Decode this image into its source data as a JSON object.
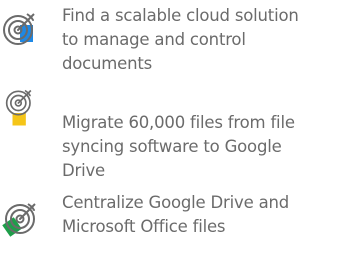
{
  "goals": [
    {
      "icon": "target-icon",
      "accent": "#1e88e5",
      "lines": [
        "Find a scalable cloud solution",
        "to manage and control",
        "documents"
      ]
    },
    {
      "icon": "target-icon",
      "accent": "#f5c518",
      "lines": [
        "Migrate 60,000 files from file",
        "syncing software to Google",
        "Drive"
      ]
    },
    {
      "icon": "target-icon",
      "accent": "#1e9e4a",
      "lines": [
        "Centralize Google Drive and",
        "Microsoft Office files"
      ]
    }
  ]
}
